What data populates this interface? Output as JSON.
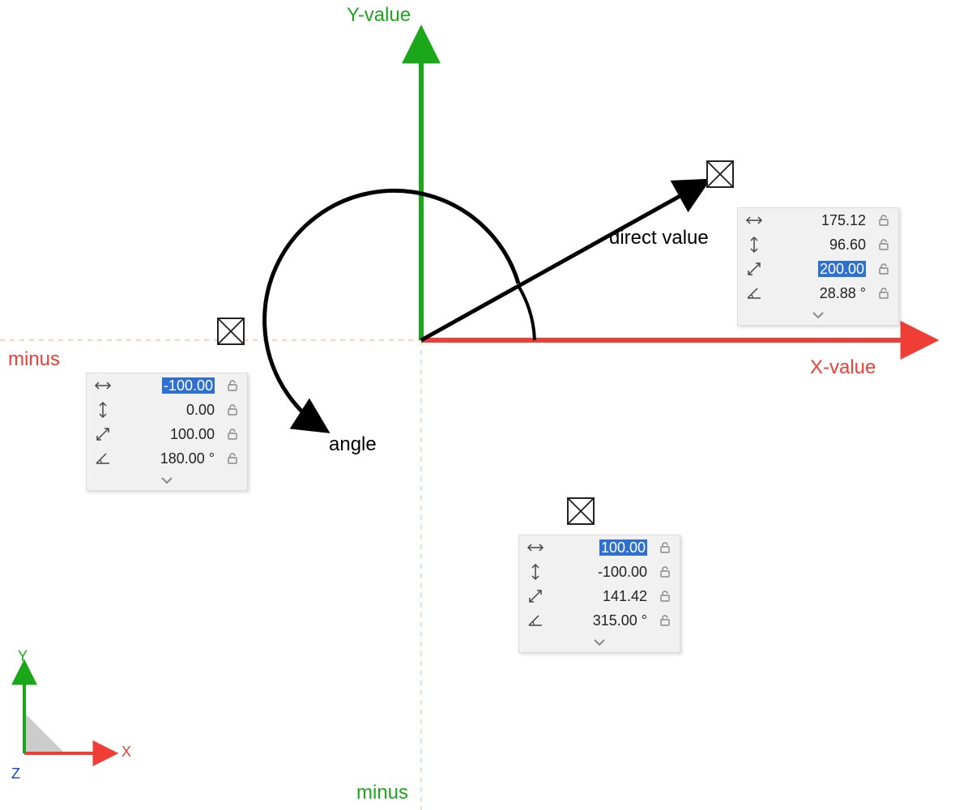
{
  "axes": {
    "x_label": "X-value",
    "y_label": "Y-value",
    "minus_x": "minus",
    "minus_y": "minus",
    "direct_value": "direct value",
    "angle": "angle"
  },
  "panels": {
    "left": {
      "x": "-100.00",
      "y": "0.00",
      "len": "100.00",
      "angle": "180.00 °",
      "highlight": "x"
    },
    "right": {
      "x": "175.12",
      "y": "96.60",
      "len": "200.00",
      "angle": "28.88 °",
      "highlight": "len"
    },
    "bottom": {
      "x": "100.00",
      "y": "-100.00",
      "len": "141.42",
      "angle": "315.00 °",
      "highlight": "x"
    }
  },
  "gizmo": {
    "x": "X",
    "y": "Y",
    "z": "Z"
  },
  "colors": {
    "red": "#ef3e36",
    "green": "#1aa81a",
    "blue": "#1142d6",
    "panel_bg": "#f1f1f1",
    "highlight": "#2f6fd0"
  }
}
